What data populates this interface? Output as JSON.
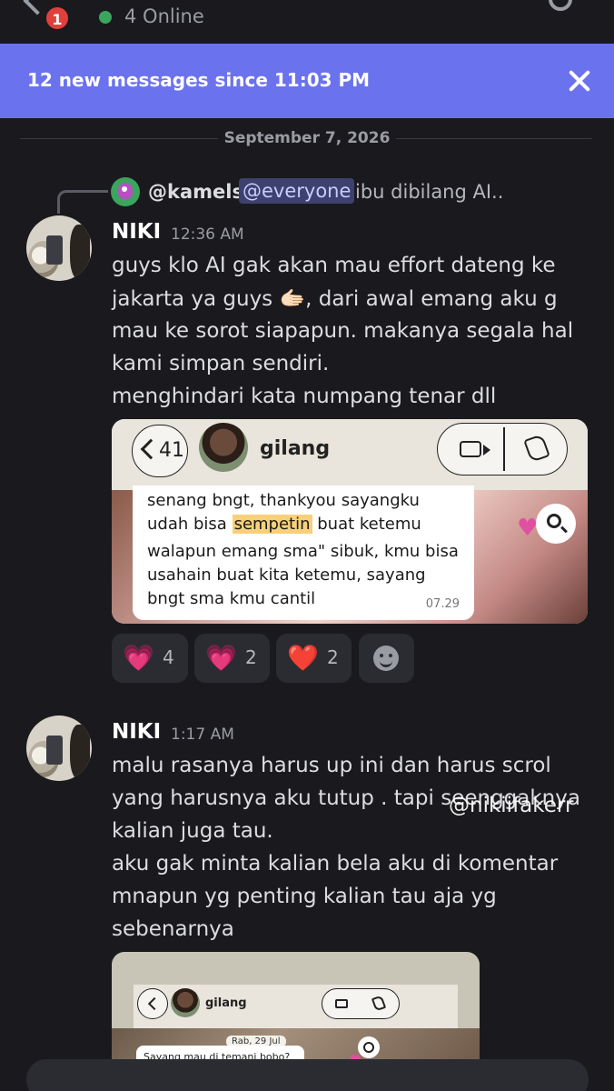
{
  "header": {
    "unread_badge": "1",
    "online_status": "4 Online"
  },
  "banner": {
    "text": "12 new messages since 11:03 PM"
  },
  "date_divider": "September 7, 2026",
  "reply": {
    "user": "@kamels",
    "mention": "@everyone",
    "snippet": "ibu dibilang AI.."
  },
  "messages": [
    {
      "author": "NIKI",
      "time": "12:36 AM",
      "lines": [
        "guys klo AI gak akan mau effort dateng ke",
        "jakarta ya guys 🫱🏻, dari awal emang aku g",
        "mau ke sorot siapapun. makanya segala hal",
        "kami simpan sendiri.",
        "menghindari kata numpang tenar dll"
      ],
      "attachment": {
        "back_count": "41",
        "contact": "gilang",
        "lines": [
          "senang bngt, thankyou sayangku",
          "udah bisa ",
          "sempetin",
          " buat ketemu",
          "walapun emang sma\" sibuk, kmu bisa",
          "usahain buat kita ketemu, sayang",
          "bngt sma kmu cantil"
        ],
        "time": "07.29"
      },
      "reactions": [
        {
          "emoji": "💗",
          "count": "4"
        },
        {
          "emoji": "💗",
          "count": "2"
        },
        {
          "emoji": "❤️",
          "count": "2"
        }
      ]
    },
    {
      "author": "NIKI",
      "time": "1:17 AM",
      "lines": [
        "malu rasanya harus up ini dan harus scrol",
        "yang harusnya aku tutup . tapi seenggaknya",
        "kalian juga tau.",
        "aku gak minta kalian bela aku di komentar",
        "mnapun yg penting kalian tau aja yg",
        "sebenarnya"
      ],
      "attachment": {
        "contact": "gilang",
        "date_pill": "Rab, 29 Jul",
        "bubble": "Sayang mau di temani bobo?"
      }
    }
  ],
  "watermark": "@nikiifakerr",
  "colors": {
    "background": "#1a1a1e",
    "banner": "#6b72ee",
    "mention_bg": "#3c4170",
    "online": "#3ba55d",
    "badge": "#e0403b"
  }
}
